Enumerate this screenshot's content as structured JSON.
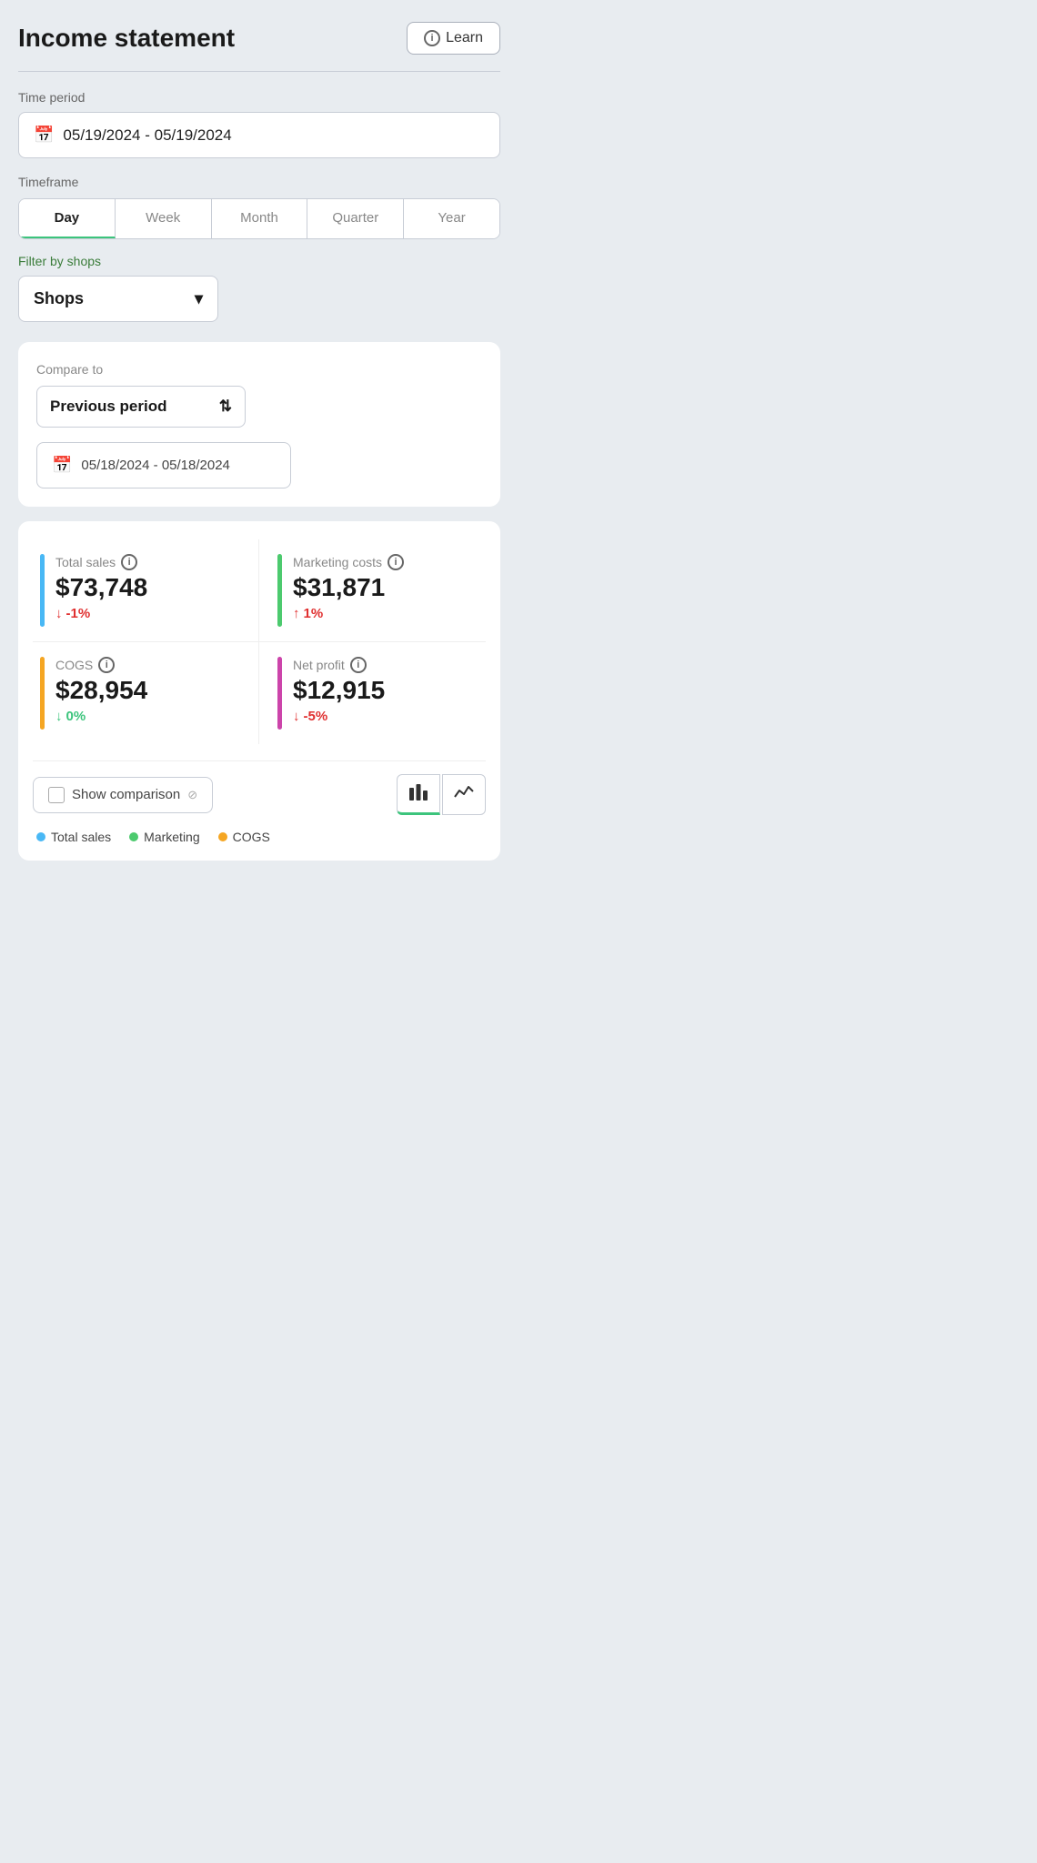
{
  "header": {
    "title": "Income statement",
    "learn_label": "Learn"
  },
  "time_period": {
    "label": "Time period",
    "value": "05/19/2024 - 05/19/2024"
  },
  "timeframe": {
    "label": "Timeframe",
    "tabs": [
      "Day",
      "Week",
      "Month",
      "Quarter",
      "Year"
    ],
    "active": "Day"
  },
  "filter": {
    "label": "Filter by shops",
    "value": "Shops"
  },
  "compare": {
    "label": "Compare to",
    "select_value": "Previous period",
    "date_value": "05/18/2024 - 05/18/2024"
  },
  "metrics": [
    {
      "name": "Total sales",
      "value": "$73,748",
      "change": "-1%",
      "change_type": "down-red",
      "color": "#49b8f5"
    },
    {
      "name": "Marketing costs",
      "value": "$31,871",
      "change": "1%",
      "change_type": "up-red",
      "color": "#4cca6e"
    },
    {
      "name": "COGS",
      "value": "$28,954",
      "change": "0%",
      "change_type": "down-green",
      "color": "#f5a623"
    },
    {
      "name": "Net profit",
      "value": "$12,915",
      "change": "-5%",
      "change_type": "down-red",
      "color": "#cc44aa"
    }
  ],
  "bottom": {
    "show_comparison_label": "Show comparison",
    "legend": [
      {
        "label": "Total sales",
        "color": "#49b8f5"
      },
      {
        "label": "Marketing",
        "color": "#4cca6e"
      },
      {
        "label": "COGS",
        "color": "#f5a623"
      }
    ]
  },
  "icons": {
    "info": "i",
    "calendar": "📅",
    "chevron_down": "▾",
    "updown": "⇅",
    "bar_chart": "▐▌",
    "line_chart": "〜"
  }
}
